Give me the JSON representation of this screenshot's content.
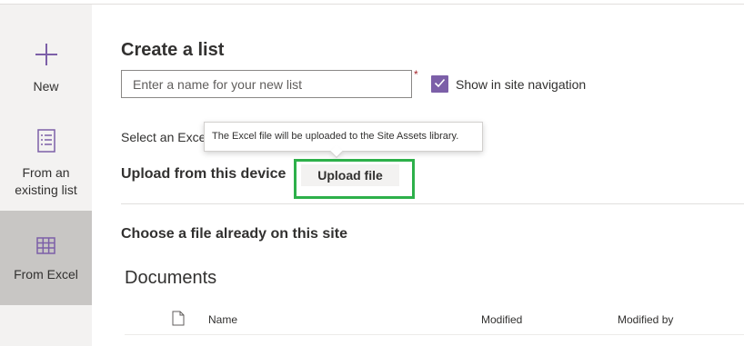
{
  "sidebar": {
    "items": [
      {
        "label": "New",
        "icon": "plus-icon",
        "selected": false
      },
      {
        "label": "From an existing list",
        "icon": "list-icon",
        "selected": false
      },
      {
        "label": "From Excel",
        "icon": "table-icon",
        "selected": true
      }
    ]
  },
  "main": {
    "title": "Create a list",
    "name_input": {
      "placeholder": "Enter a name for your new list",
      "value": "",
      "required_mark": "*"
    },
    "show_in_nav": {
      "label": "Show in site navigation",
      "checked": true
    },
    "select_excel_text": "Select an Excel",
    "tooltip": "The Excel file will be uploaded to the Site Assets library.",
    "upload_section": {
      "heading": "Upload from this device",
      "button_label": "Upload file"
    },
    "choose_section": {
      "heading": "Choose a file already on this site"
    },
    "documents": {
      "title": "Documents",
      "columns": [
        "Name",
        "Modified",
        "Modified by"
      ],
      "file_icon": "document-icon"
    }
  },
  "colors": {
    "accent": "#7c5fa8",
    "highlight_border": "#2db04a",
    "sidebar_bg": "#f3f2f1",
    "selected_bg": "#c8c6c4"
  }
}
